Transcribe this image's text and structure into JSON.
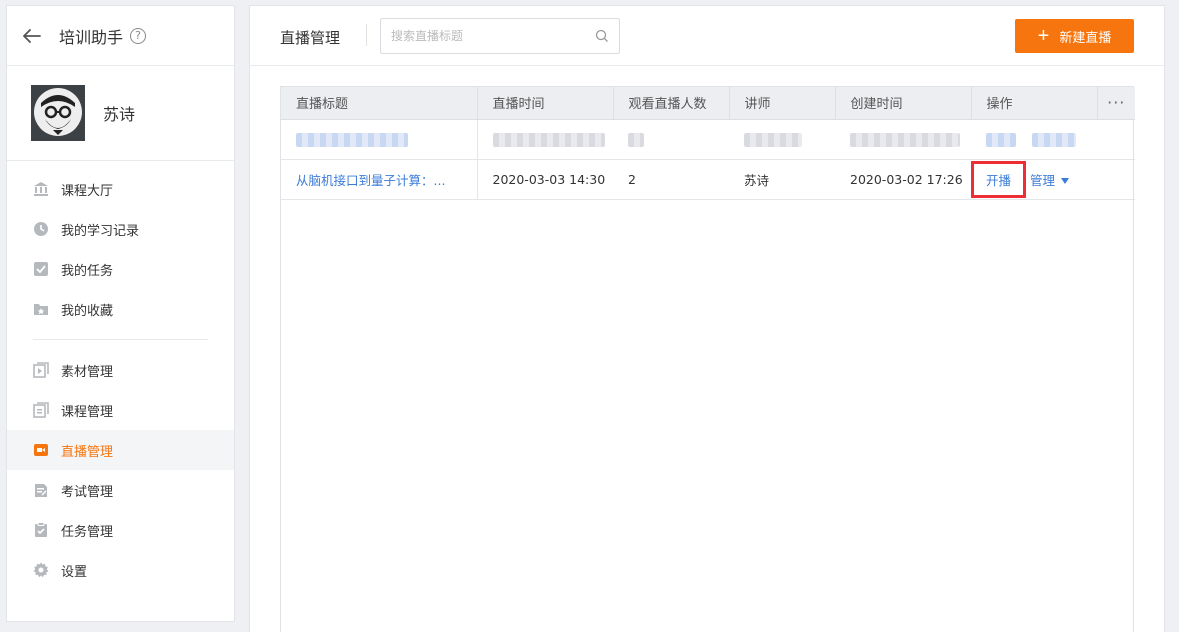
{
  "sidebar": {
    "title": "培训助手",
    "help_glyph": "?",
    "user_name": "苏诗",
    "menu_group1": [
      {
        "label": "课程大厅",
        "icon": "bank-icon"
      },
      {
        "label": "我的学习记录",
        "icon": "clock-icon"
      },
      {
        "label": "我的任务",
        "icon": "checkbox-icon"
      },
      {
        "label": "我的收藏",
        "icon": "star-folder-icon"
      }
    ],
    "menu_group2": [
      {
        "label": "素材管理",
        "icon": "media-icon"
      },
      {
        "label": "课程管理",
        "icon": "course-icon"
      },
      {
        "label": "直播管理",
        "icon": "live-camera-icon",
        "active": true
      },
      {
        "label": "考试管理",
        "icon": "exam-icon"
      },
      {
        "label": "任务管理",
        "icon": "task-icon"
      },
      {
        "label": "设置",
        "icon": "gear-icon"
      }
    ]
  },
  "header": {
    "title": "直播管理",
    "search_placeholder": "搜索直播标题",
    "new_button": "新建直播",
    "new_button_glyph": "+"
  },
  "table": {
    "columns": [
      "直播标题",
      "直播时间",
      "观看直播人数",
      "讲师",
      "创建时间",
      "操作"
    ],
    "more_glyph": "···",
    "rows": [
      {
        "title": "从脑机接口到量子计算：...",
        "time": "2020-03-03 14:30",
        "viewers": "2",
        "lecturer": "苏诗",
        "created": "2020-03-02 17:26",
        "action_start": "开播",
        "action_manage": "管理"
      }
    ]
  },
  "colors": {
    "accent": "#f7750e",
    "link": "#3b7cd9",
    "highlight": "#ef2d36"
  }
}
